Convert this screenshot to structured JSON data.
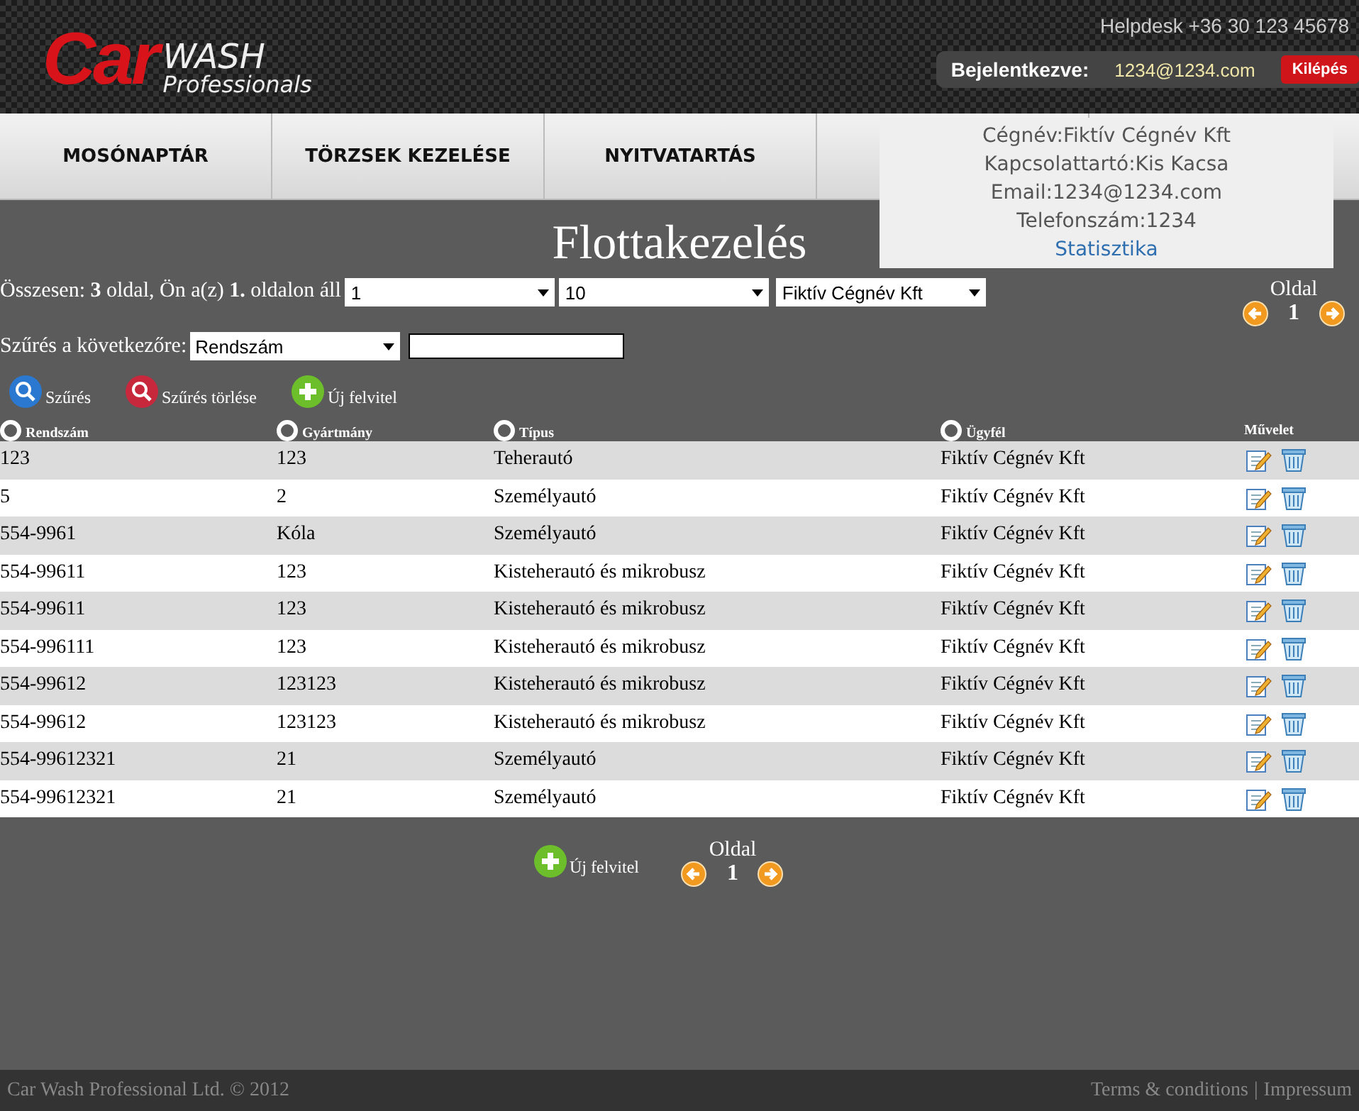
{
  "header": {
    "logo_car": "Car",
    "logo_wash": "WASH",
    "logo_sub": "Professionals",
    "helpdesk": "Helpdesk +36 30 123 45678",
    "login": {
      "label": "Bejelentkezve:",
      "email": "1234@1234.com",
      "logout": "Kilépés"
    }
  },
  "nav": [
    {
      "label": "MOSÓNAPTÁR"
    },
    {
      "label": "TÖRZSEK KEZELÉSE"
    },
    {
      "label": "NYITVATARTÁS"
    }
  ],
  "popup": {
    "lines": [
      "Cégnév:Fiktív Cégnév Kft",
      "Kapcsolattartó:Kis Kacsa",
      "Email:1234@1234.com",
      "Telefonszám:1234"
    ],
    "link": "Statisztika"
  },
  "title": "Flottakezelés",
  "summary": "Összesen: **3** oldal, Ön a(z) **1.** oldalon áll",
  "selects": [
    "1",
    "10",
    "Fiktív Cégnév Kft"
  ],
  "pager_top": {
    "label": "Oldal",
    "page": "1"
  },
  "filter": {
    "label": "Szűrés a következőre:",
    "field": "Rendszám"
  },
  "actions": [
    {
      "kind": "search",
      "label": "Szűrés"
    },
    {
      "kind": "clear",
      "label": "Szűrés törlése"
    },
    {
      "kind": "add",
      "label": "Új felvitel"
    }
  ],
  "table": {
    "columns": [
      {
        "label": "Rendszám",
        "sortable": true
      },
      {
        "label": "Gyártmány",
        "sortable": true
      },
      {
        "label": "Típus",
        "sortable": true
      },
      {
        "label": "Ügyfél",
        "sortable": true
      },
      {
        "label": "Művelet",
        "sortable": false
      }
    ],
    "rows": [
      [
        "123",
        "123",
        "Teherautó",
        "Fiktív Cégnév Kft"
      ],
      [
        "5",
        "2",
        "Személyautó",
        "Fiktív Cégnév Kft"
      ],
      [
        "554-9961",
        "Kóla",
        "Személyautó",
        "Fiktív Cégnév Kft"
      ],
      [
        "554-99611",
        "123",
        "Kisteherautó és mikrobusz",
        "Fiktív Cégnév Kft"
      ],
      [
        "554-99611",
        "123",
        "Kisteherautó és mikrobusz",
        "Fiktív Cégnév Kft"
      ],
      [
        "554-996111",
        "123",
        "Kisteherautó és mikrobusz",
        "Fiktív Cégnév Kft"
      ],
      [
        "554-99612",
        "123123",
        "Kisteherautó és mikrobusz",
        "Fiktív Cégnév Kft"
      ],
      [
        "554-99612",
        "123123",
        "Kisteherautó és mikrobusz",
        "Fiktív Cégnév Kft"
      ],
      [
        "554-99612321",
        "21",
        "Személyautó",
        "Fiktív Cégnév Kft"
      ],
      [
        "554-99612321",
        "21",
        "Személyautó",
        "Fiktív Cégnév Kft"
      ]
    ]
  },
  "bottom": {
    "add": "Új felvitel",
    "pager_label": "Oldal",
    "page": "1"
  },
  "footer": {
    "copyright": "Car Wash Professional Ltd. © 2012",
    "terms": "Terms & conditions",
    "separator": "|",
    "impressum": "Impressum"
  }
}
